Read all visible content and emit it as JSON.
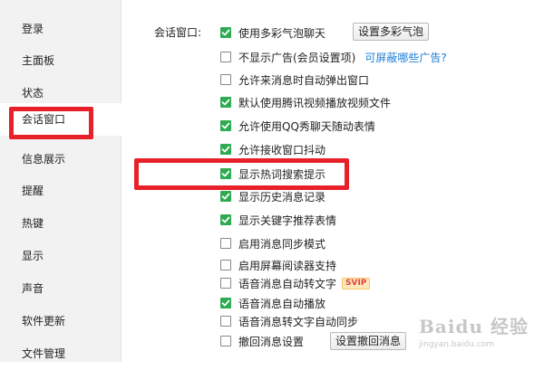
{
  "sidebar": {
    "items": [
      {
        "label": "登录"
      },
      {
        "label": "主面板"
      },
      {
        "label": "状态"
      },
      {
        "label": "会话窗口",
        "active": true
      },
      {
        "label": "信息展示"
      },
      {
        "label": "提醒"
      },
      {
        "label": "热键"
      },
      {
        "label": "显示"
      },
      {
        "label": "声音"
      },
      {
        "label": "软件更新"
      },
      {
        "label": "文件管理"
      }
    ]
  },
  "section": {
    "label": "会话窗口:"
  },
  "options": [
    {
      "label": "使用多彩气泡聊天",
      "checked": true,
      "button": "设置多彩气泡"
    },
    {
      "label": "不显示广告(会员设置项)",
      "checked": false,
      "link": "可屏蔽哪些广告?"
    },
    {
      "label": "允许来消息时自动弹出窗口",
      "checked": false
    },
    {
      "label": "默认使用腾讯视频播放视频文件",
      "checked": true
    },
    {
      "label": "允许使用QQ秀聊天随动表情",
      "checked": true
    },
    {
      "label": "允许接收窗口抖动",
      "checked": true
    },
    {
      "label": "显示热词搜索提示",
      "checked": true
    },
    {
      "label": "显示历史消息记录",
      "checked": true
    },
    {
      "label": "显示关键字推荐表情",
      "checked": true
    },
    {
      "label": "启用消息同步模式",
      "checked": false
    },
    {
      "label": "启用屏幕阅读器支持",
      "checked": false
    },
    {
      "label": "语音消息自动转文字",
      "checked": false,
      "badge": "SVIP"
    },
    {
      "label": "语音消息自动播放",
      "checked": true
    },
    {
      "label": "语音消息转文字自动同步",
      "checked": false
    },
    {
      "label": "撤回消息设置",
      "checked": false,
      "button": "设置撤回消息"
    }
  ],
  "colors": {
    "check": "#2eaa52",
    "link": "#1c7fd6",
    "highlight": "#e8202a"
  },
  "watermark": {
    "main": "Baidu 经验",
    "sub": "jingyan.baidu.com"
  }
}
